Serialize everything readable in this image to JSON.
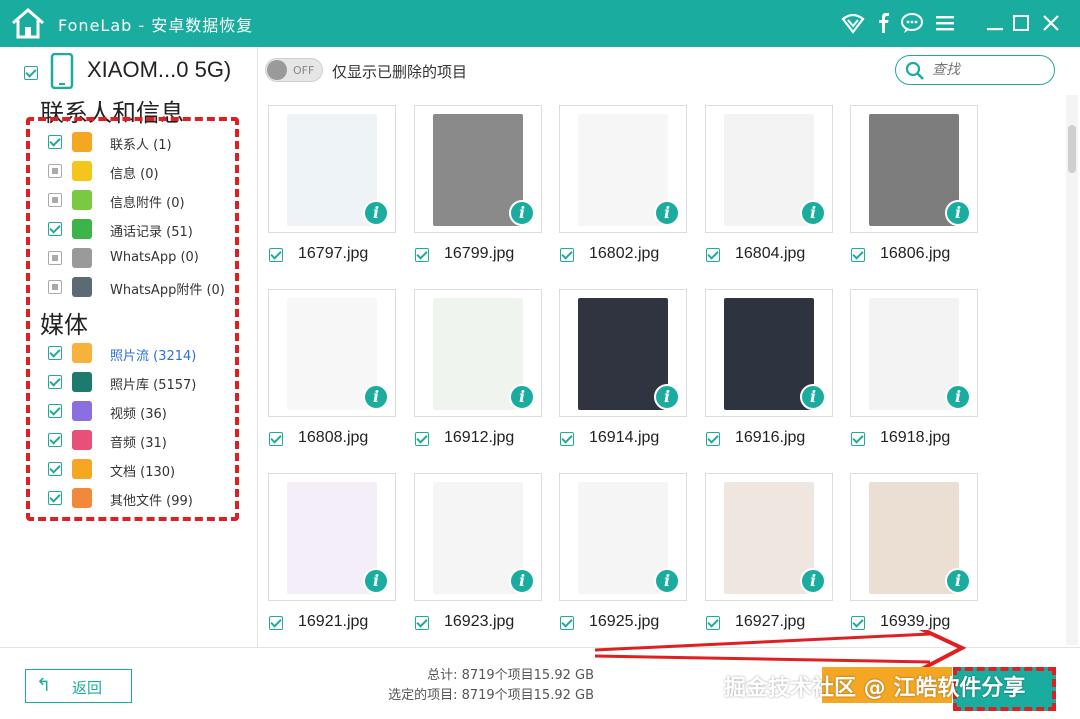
{
  "app": {
    "title": "FoneLab  -  安卓数据恢复"
  },
  "titlebar_icons": [
    "wifi-icon",
    "facebook-icon",
    "chat-icon",
    "menu-icon",
    "minimize-icon",
    "maximize-icon",
    "close-icon"
  ],
  "device": {
    "name": "XIAOM...0 5G)"
  },
  "groups": {
    "contacts_title": "联系人和信息",
    "media_title": "媒体"
  },
  "categories": [
    {
      "label": "联系人 (1)",
      "icon": "contacts-icon",
      "color": "#f5a623",
      "state": "checked"
    },
    {
      "label": "信息 (0)",
      "icon": "message-icon",
      "color": "#f5c51c",
      "state": "partial"
    },
    {
      "label": "信息附件 (0)",
      "icon": "attachment-icon",
      "color": "#7ac943",
      "state": "partial"
    },
    {
      "label": "通话记录 (51)",
      "icon": "call-log-icon",
      "color": "#3bb54a",
      "state": "checked"
    },
    {
      "label": "WhatsApp (0)",
      "icon": "whatsapp-icon",
      "color": "#9a9a9a",
      "state": "partial"
    },
    {
      "label": "WhatsApp附件 (0)",
      "icon": "whatsapp-attachment-icon",
      "color": "#5c6b73",
      "state": "partial"
    },
    {
      "label": "照片流 (3214)",
      "icon": "photo-stream-icon",
      "color": "#f7b23b",
      "state": "checked"
    },
    {
      "label": "照片库 (5157)",
      "icon": "photo-library-icon",
      "color": "#1f7a6e",
      "state": "checked"
    },
    {
      "label": "视频 (36)",
      "icon": "video-icon",
      "color": "#8b6fe0",
      "state": "checked"
    },
    {
      "label": "音频 (31)",
      "icon": "audio-icon",
      "color": "#e8507a",
      "state": "checked"
    },
    {
      "label": "文档 (130)",
      "icon": "document-icon",
      "color": "#f5a623",
      "state": "checked"
    },
    {
      "label": "其他文件 (99)",
      "icon": "other-files-icon",
      "color": "#f08a3a",
      "state": "checked"
    }
  ],
  "toolbar": {
    "toggle_label": "OFF",
    "only_deleted": "仅显示已删除的项目",
    "search_placeholder": "查找"
  },
  "files": [
    {
      "name": "16797.jpg",
      "thumb": "#eef3f7"
    },
    {
      "name": "16799.jpg",
      "thumb": "#8a8a8a"
    },
    {
      "name": "16802.jpg",
      "thumb": "#f6f6f6"
    },
    {
      "name": "16804.jpg",
      "thumb": "#f3f3f3"
    },
    {
      "name": "16806.jpg",
      "thumb": "#7d7d7d"
    },
    {
      "name": "16808.jpg",
      "thumb": "#f7f7f7"
    },
    {
      "name": "16912.jpg",
      "thumb": "#f0f4ee"
    },
    {
      "name": "16914.jpg",
      "thumb": "#2f3440"
    },
    {
      "name": "16916.jpg",
      "thumb": "#2e3340"
    },
    {
      "name": "16918.jpg",
      "thumb": "#f3f3f3"
    },
    {
      "name": "16921.jpg",
      "thumb": "#f4eef8"
    },
    {
      "name": "16923.jpg",
      "thumb": "#f5f5f5"
    },
    {
      "name": "16925.jpg",
      "thumb": "#f5f5f5"
    },
    {
      "name": "16927.jpg",
      "thumb": "#efe7df"
    },
    {
      "name": "16939.jpg",
      "thumb": "#eadfd2"
    }
  ],
  "footer": {
    "back_label": "返回",
    "total": "总计: 8719个项目15.92 GB",
    "selected": "选定的项目: 8719个项目15.92 GB",
    "watermark": "掘金技术社区 @ 江皓软件分享"
  }
}
